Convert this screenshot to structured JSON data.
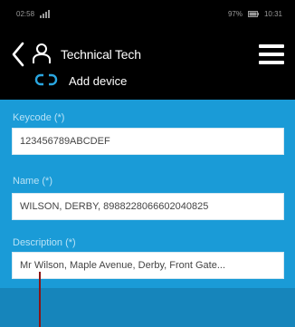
{
  "status_bar": {
    "left_text": "02:58",
    "right_text": "97%",
    "time": "10:31"
  },
  "header": {
    "technician_name": "Technical Tech",
    "add_device_label": "Add device"
  },
  "form": {
    "keycode": {
      "label": "Keycode (*)",
      "value": "123456789ABCDEF"
    },
    "name": {
      "label": "Name (*)",
      "value": "WILSON, DERBY, 8988228066602040825"
    },
    "description": {
      "label": "Description (*)",
      "value": "Mr Wilson, Maple Avenue, Derby, Front Gate..."
    }
  },
  "colors": {
    "header_bg": "#000000",
    "form_bg": "#1a9bd7",
    "footer_band": "#1685bb"
  }
}
